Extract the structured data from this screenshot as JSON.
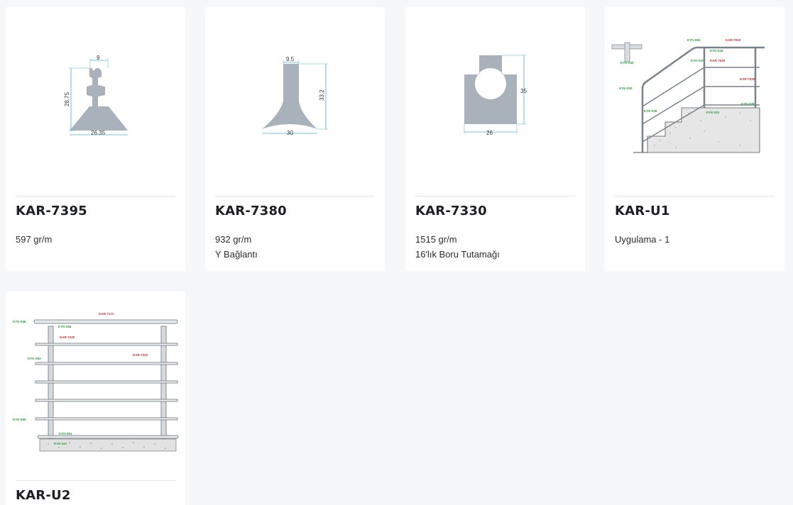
{
  "products": [
    {
      "code": "KAR-7395",
      "weight": "597 gr/m",
      "desc": "",
      "dims": {
        "top": "9",
        "height": "28.75",
        "base": "26.35"
      }
    },
    {
      "code": "KAR-7380",
      "weight": "932 gr/m",
      "desc": "Y Bağlantı",
      "dims": {
        "top": "9.5",
        "height": "33.2",
        "base": "30"
      }
    },
    {
      "code": "KAR-7330",
      "weight": "1515 gr/m",
      "desc": "16'lık Boru Tutamağı",
      "dims": {
        "height": "35",
        "base": "26"
      }
    },
    {
      "code": "KAR-U1",
      "weight": "Uygulama - 1",
      "desc": "",
      "labels": [
        "KYK-062",
        "KAR-7010",
        "KYK-046",
        "KAR-7020",
        "KYK-047",
        "KAR-7030",
        "KYK-032",
        "KYK-040",
        "KYK-036",
        "KYK-021",
        "KYK-029"
      ]
    },
    {
      "code": "KAR-U2",
      "weight": "",
      "desc": "",
      "labels": [
        "KAR-7171",
        "KYK-046",
        "KYK-044",
        "KAR-7230",
        "KAR-7220",
        "KYK-053",
        "KYK-050",
        "KYK-051",
        "KYK-047"
      ]
    }
  ],
  "colors": {
    "profile": "#a9b2bb",
    "dimension": "#4ab3d6",
    "label_green": "#2a9a3a",
    "label_red": "#d42a2a"
  }
}
